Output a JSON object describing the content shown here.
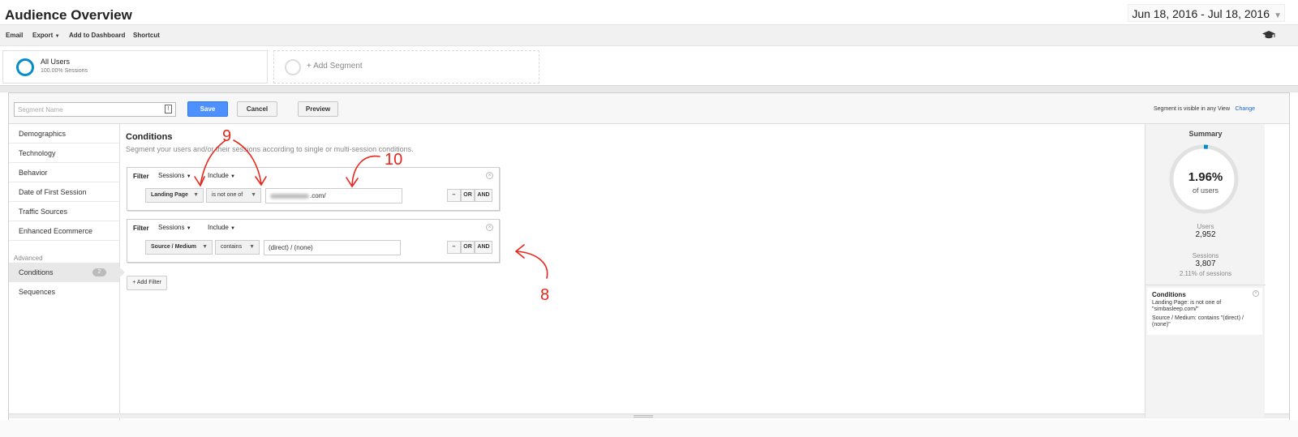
{
  "header": {
    "title": "Audience Overview",
    "date_range": "Jun 18, 2016 - Jul 18, 2016"
  },
  "toolbar": {
    "email": "Email",
    "export": "Export",
    "add_to_dashboard": "Add to Dashboard",
    "shortcut": "Shortcut"
  },
  "segments": {
    "active": {
      "name": "All Users",
      "sub": "100.00% Sessions"
    },
    "add_label": "+ Add Segment"
  },
  "editor": {
    "name_placeholder": "Segment Name",
    "save": "Save",
    "cancel": "Cancel",
    "preview": "Preview",
    "visibility_note": "Segment is visible in any View",
    "change": "Change"
  },
  "nav": {
    "items": [
      "Demographics",
      "Technology",
      "Behavior",
      "Date of First Session",
      "Traffic Sources",
      "Enhanced Ecommerce"
    ],
    "advanced_label": "Advanced",
    "conditions": "Conditions",
    "conditions_badge": "2",
    "sequences": "Sequences"
  },
  "conditions": {
    "title": "Conditions",
    "description": "Segment your users and/or their sessions according to single or multi-session conditions.",
    "filters": [
      {
        "label": "Filter",
        "scope": "Sessions",
        "mode": "Include",
        "dimension": "Landing Page",
        "operator": "is not one of",
        "value": ".com/"
      },
      {
        "label": "Filter",
        "scope": "Sessions",
        "mode": "Include",
        "dimension": "Source / Medium",
        "operator": "contains",
        "value": "(direct) / (none)"
      }
    ],
    "btn_minus": "–",
    "btn_or": "OR",
    "btn_and": "AND",
    "add_filter": "+ Add Filter"
  },
  "summary": {
    "title": "Summary",
    "percent": "1.96%",
    "percent_label": "of users",
    "percent_fraction": 0.0196,
    "users_label": "Users",
    "users_value": "2,952",
    "sessions_label": "Sessions",
    "sessions_value": "3,807",
    "sessions_pct": "2.11% of sessions",
    "conditions_title": "Conditions",
    "condition_1": "Landing Page: is not one of \"simbasleep.com/\"",
    "condition_2": "Source / Medium: contains \"(direct) / (none)\""
  },
  "annotations": {
    "a9": "9",
    "a10": "10",
    "a8": "8"
  },
  "colors": {
    "accent": "#058dc7",
    "save_button": "#4d90fe",
    "annotation": "#e8261c"
  }
}
